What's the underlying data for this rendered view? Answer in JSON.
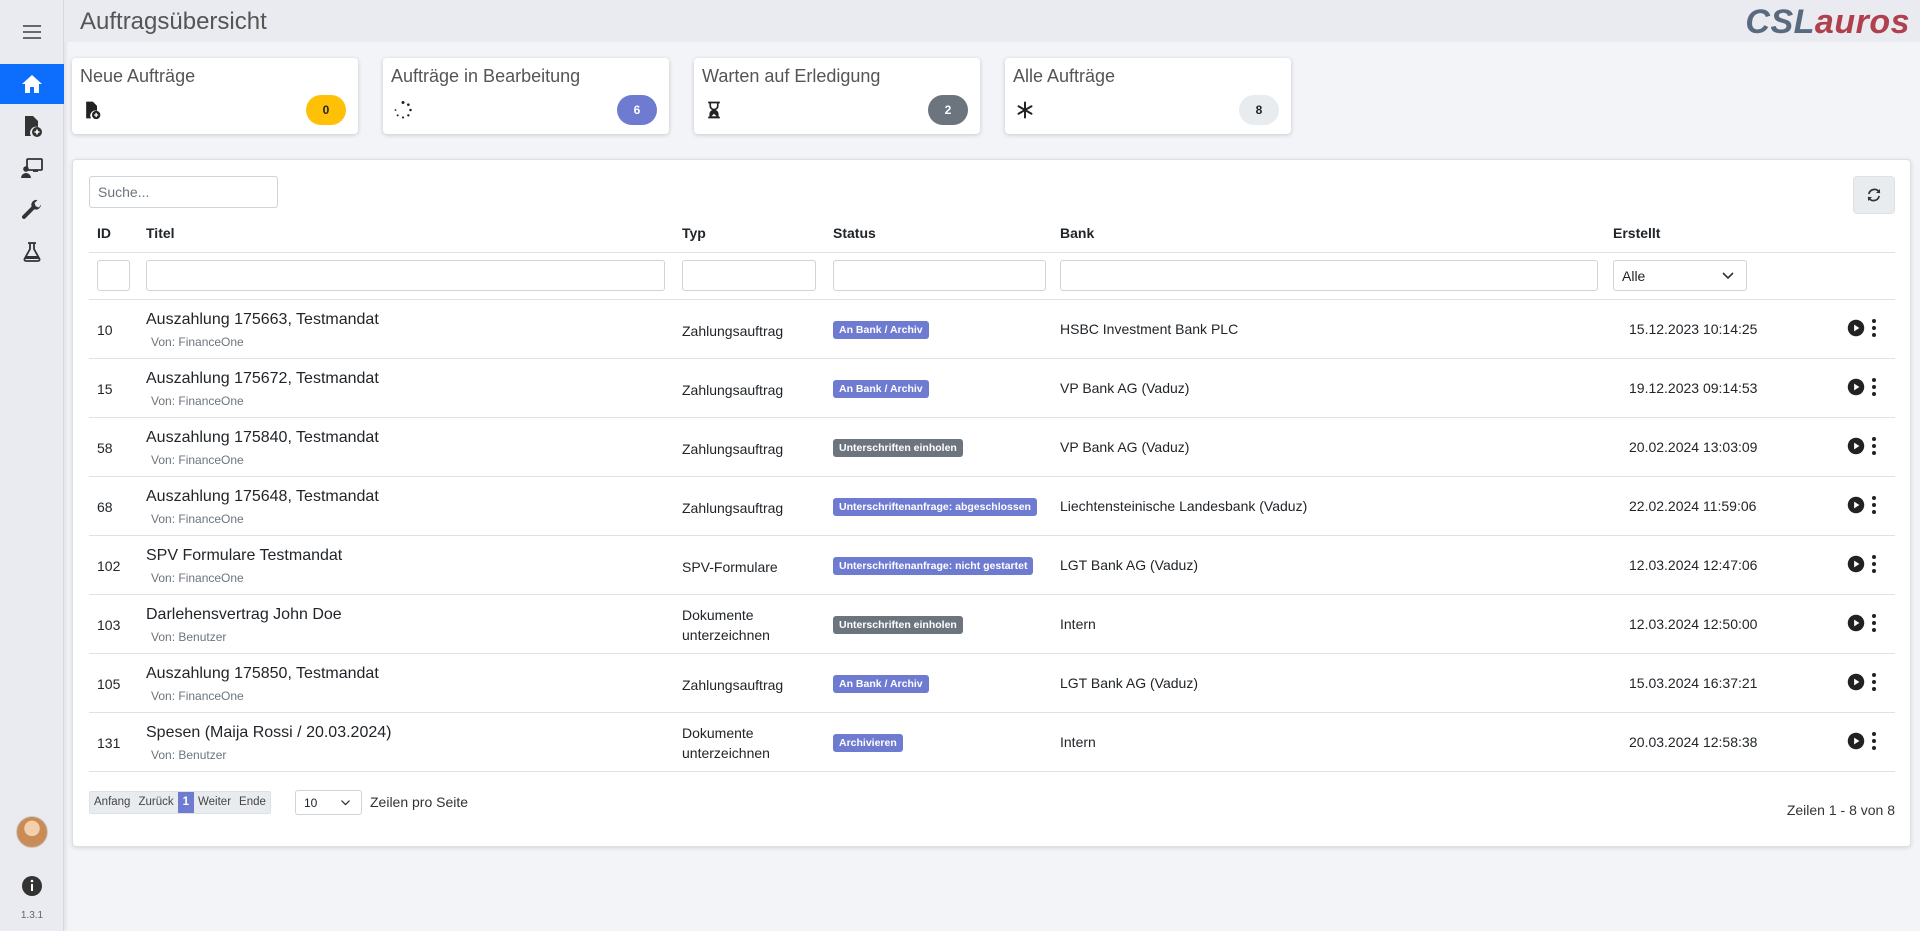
{
  "header": {
    "title": "Auftragsübersicht",
    "logo_part1": "CSL",
    "logo_part2": "auros"
  },
  "colors": {
    "primary": "#0d6efd",
    "warning": "#ffc107",
    "info": "#6f7bd0",
    "secondary": "#6c757d",
    "light": "#e9ecef"
  },
  "sidebar": {
    "items": [
      "menu-icon",
      "home-icon",
      "file-add-icon",
      "user-screen-icon",
      "wrench-icon",
      "flask-icon"
    ],
    "version": "1.3.1"
  },
  "stats": [
    {
      "label": "Neue Aufträge",
      "count": "0",
      "icon": "file-add-icon"
    },
    {
      "label": "Aufträge in Bearbeitung",
      "count": "6",
      "icon": "spinner-icon"
    },
    {
      "label": "Warten auf Erledigung",
      "count": "2",
      "icon": "hourglass-icon"
    },
    {
      "label": "Alle Aufträge",
      "count": "8",
      "icon": "asterisk-icon"
    }
  ],
  "table": {
    "search_placeholder": "Suche...",
    "columns": {
      "id": "ID",
      "title": "Titel",
      "type": "Typ",
      "status": "Status",
      "bank": "Bank",
      "created": "Erstellt"
    },
    "created_filter": "Alle",
    "rows": [
      {
        "id": "10",
        "title": "Auszahlung 175663, Testmandat",
        "from": "Von: FinanceOne",
        "type": "Zahlungsauftrag",
        "status": "An Bank / Archiv",
        "status_color": "#6f7bd0",
        "bank": "HSBC Investment Bank PLC",
        "created": "15.12.2023 10:14:25"
      },
      {
        "id": "15",
        "title": "Auszahlung 175672, Testmandat",
        "from": "Von: FinanceOne",
        "type": "Zahlungsauftrag",
        "status": "An Bank / Archiv",
        "status_color": "#6f7bd0",
        "bank": "VP Bank AG (Vaduz)",
        "created": "19.12.2023 09:14:53"
      },
      {
        "id": "58",
        "title": "Auszahlung 175840, Testmandat",
        "from": "Von: FinanceOne",
        "type": "Zahlungsauftrag",
        "status": "Unterschriften einholen",
        "status_color": "#6c757d",
        "bank": "VP Bank AG (Vaduz)",
        "created": "20.02.2024 13:03:09"
      },
      {
        "id": "68",
        "title": "Auszahlung 175648, Testmandat",
        "from": "Von: FinanceOne",
        "type": "Zahlungsauftrag",
        "status": "Unterschriftenanfrage: abgeschlossen",
        "status_color": "#6f7bd0",
        "bank": "Liechtensteinische Landesbank (Vaduz)",
        "created": "22.02.2024 11:59:06"
      },
      {
        "id": "102",
        "title": "SPV Formulare Testmandat",
        "from": "Von: FinanceOne",
        "type": "SPV-Formulare",
        "status": "Unterschriftenanfrage: nicht gestartet",
        "status_color": "#6f7bd0",
        "bank": "LGT Bank AG (Vaduz)",
        "created": "12.03.2024 12:47:06"
      },
      {
        "id": "103",
        "title": "Darlehensvertrag John Doe",
        "from": "Von: Benutzer",
        "type": "Dokumente unterzeichnen",
        "status": "Unterschriften einholen",
        "status_color": "#6c757d",
        "bank": "Intern",
        "created": "12.03.2024 12:50:00"
      },
      {
        "id": "105",
        "title": "Auszahlung 175850, Testmandat",
        "from": "Von: FinanceOne",
        "type": "Zahlungsauftrag",
        "status": "An Bank / Archiv",
        "status_color": "#6f7bd0",
        "bank": "LGT Bank AG (Vaduz)",
        "created": "15.03.2024 16:37:21"
      },
      {
        "id": "131",
        "title": "Spesen (Maija Rossi / 20.03.2024)",
        "from": "Von: Benutzer",
        "type": "Dokumente unterzeichnen",
        "status": "Archivieren",
        "status_color": "#6f7bd0",
        "bank": "Intern",
        "created": "20.03.2024 12:58:38"
      }
    ]
  },
  "pagination": {
    "first": "Anfang",
    "prev": "Zurück",
    "current": "1",
    "next": "Weiter",
    "last": "Ende",
    "per_page": "10",
    "per_page_label": "Zeilen pro Seite",
    "range": "Zeilen 1 - 8 von 8"
  }
}
